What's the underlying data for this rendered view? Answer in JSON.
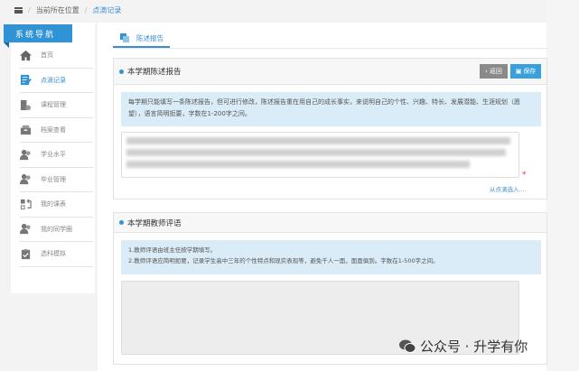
{
  "breadcrumb": {
    "items": [
      "当前所在位置",
      "点滴记录"
    ]
  },
  "sidebar": {
    "title": "系统导航",
    "items": [
      {
        "label": "首页",
        "icon": "home-icon"
      },
      {
        "label": "点滴记录",
        "icon": "edit-icon",
        "active": true
      },
      {
        "label": "课程管理",
        "icon": "course-icon"
      },
      {
        "label": "档案查看",
        "icon": "archive-icon"
      },
      {
        "label": "学业水平",
        "icon": "user-icon"
      },
      {
        "label": "毕业管理",
        "icon": "user-icon"
      },
      {
        "label": "我的课表",
        "icon": "schedule-icon"
      },
      {
        "label": "我的同学圈",
        "icon": "user-icon"
      },
      {
        "label": "选科模拟",
        "icon": "clipboard-icon"
      }
    ]
  },
  "tab": {
    "label": "陈述报告"
  },
  "report": {
    "title": "本学期陈述报告",
    "back_label": "返回",
    "save_label": "保存",
    "info": "每学期只能填写一条陈述报告，但可进行修改，陈述报告重在用自己的成长事实，来说明自己的个性、兴趣、特长、发展潜能、生涯规划（愿望），语言简明扼要，字数在1-200字之间。",
    "required_mark": "*",
    "select_link": "从点滴选入..."
  },
  "comment": {
    "title": "本学期教师评语",
    "info_lines": [
      "1.教师评语由班主任按学期填写。",
      "2.教师评语应简明扼要，记录学生高中三年的个性特点和现实表现等，避免千人一面，面面俱到。字数在1-500字之间。"
    ]
  },
  "watermark": "公众号 · 升学有你",
  "colors": {
    "accent": "#2f93d6",
    "back_button": "#8a8a8a",
    "info_bg": "#d9ecf7"
  }
}
